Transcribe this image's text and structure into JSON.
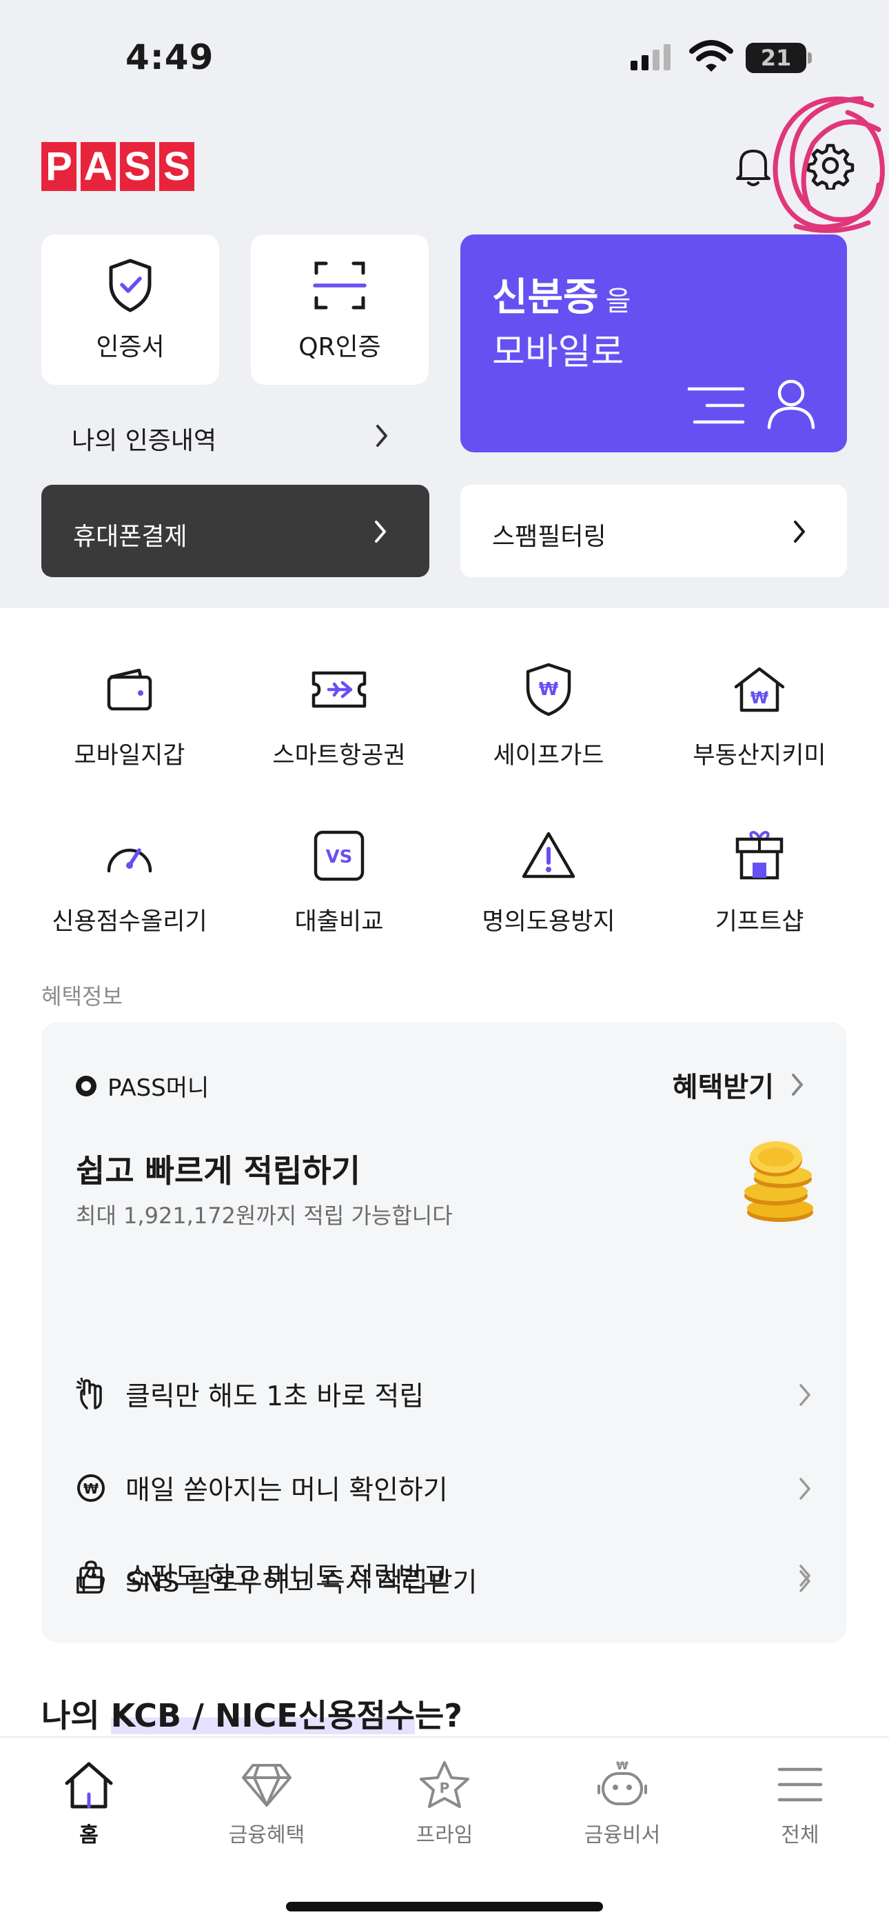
{
  "status_bar": {
    "time": "4:49",
    "battery": "21"
  },
  "header": {
    "logo_letters": [
      "P",
      "A",
      "S",
      "S"
    ]
  },
  "quick_cards": {
    "certificate_label": "인증서",
    "qr_label": "QR인증",
    "history_label": "나의 인증내역"
  },
  "id_card": {
    "title": "신분증",
    "title_suffix": "을",
    "subtitle": "모바일로"
  },
  "buttons": {
    "phone_payment": "휴대폰결제",
    "spam_filter": "스팸필터링"
  },
  "menu": [
    {
      "label": "모바일지갑",
      "icon": "wallet-icon"
    },
    {
      "label": "스마트항공권",
      "icon": "flight-ticket-icon"
    },
    {
      "label": "세이프가드",
      "icon": "safe-guard-icon"
    },
    {
      "label": "부동산지키미",
      "icon": "house-won-icon"
    },
    {
      "label": "신용점수올리기",
      "icon": "gauge-icon"
    },
    {
      "label": "대출비교",
      "icon": "vs-icon"
    },
    {
      "label": "명의도용방지",
      "icon": "warning-icon"
    },
    {
      "label": "기프트샵",
      "icon": "gift-shop-icon"
    }
  ],
  "benefit": {
    "section_label": "혜택정보",
    "brand": "PASS머니",
    "cta": "혜택받기",
    "title": "쉽고 빠르게 적립하기",
    "subtitle": "최대 1,921,172원까지 적립 가능합니다",
    "rows": [
      {
        "label": "클릭만 해도 1초 바로 적립",
        "icon": "tap-hand-icon"
      },
      {
        "label": "매일 쏟아지는 머니 확인하기",
        "icon": "won-coin-icon"
      },
      {
        "label": "SNS 팔로우하고 즉시 적립받기",
        "icon": "thumbs-up-icon"
      },
      {
        "label": "쇼핑도 하고 머니도 적립받고",
        "icon": "shopping-bag-icon"
      }
    ]
  },
  "score": {
    "prefix": "나의 ",
    "highlight": "KCB / NICE신용점수",
    "suffix": "는?"
  },
  "tabbar": {
    "tabs": [
      {
        "label": "홈",
        "icon": "home-icon",
        "active": true
      },
      {
        "label": "금융혜택",
        "icon": "diamond-icon",
        "active": false
      },
      {
        "label": "프라임",
        "icon": "prime-star-icon",
        "active": false
      },
      {
        "label": "금융비서",
        "icon": "robot-icon",
        "active": false
      },
      {
        "label": "전체",
        "icon": "menu-icon",
        "active": false
      }
    ]
  },
  "colors": {
    "brand_red": "#e8243c",
    "accent_purple": "#6650f2",
    "dark_button": "#3a3a3a",
    "annotation_pink": "#e0367a"
  }
}
